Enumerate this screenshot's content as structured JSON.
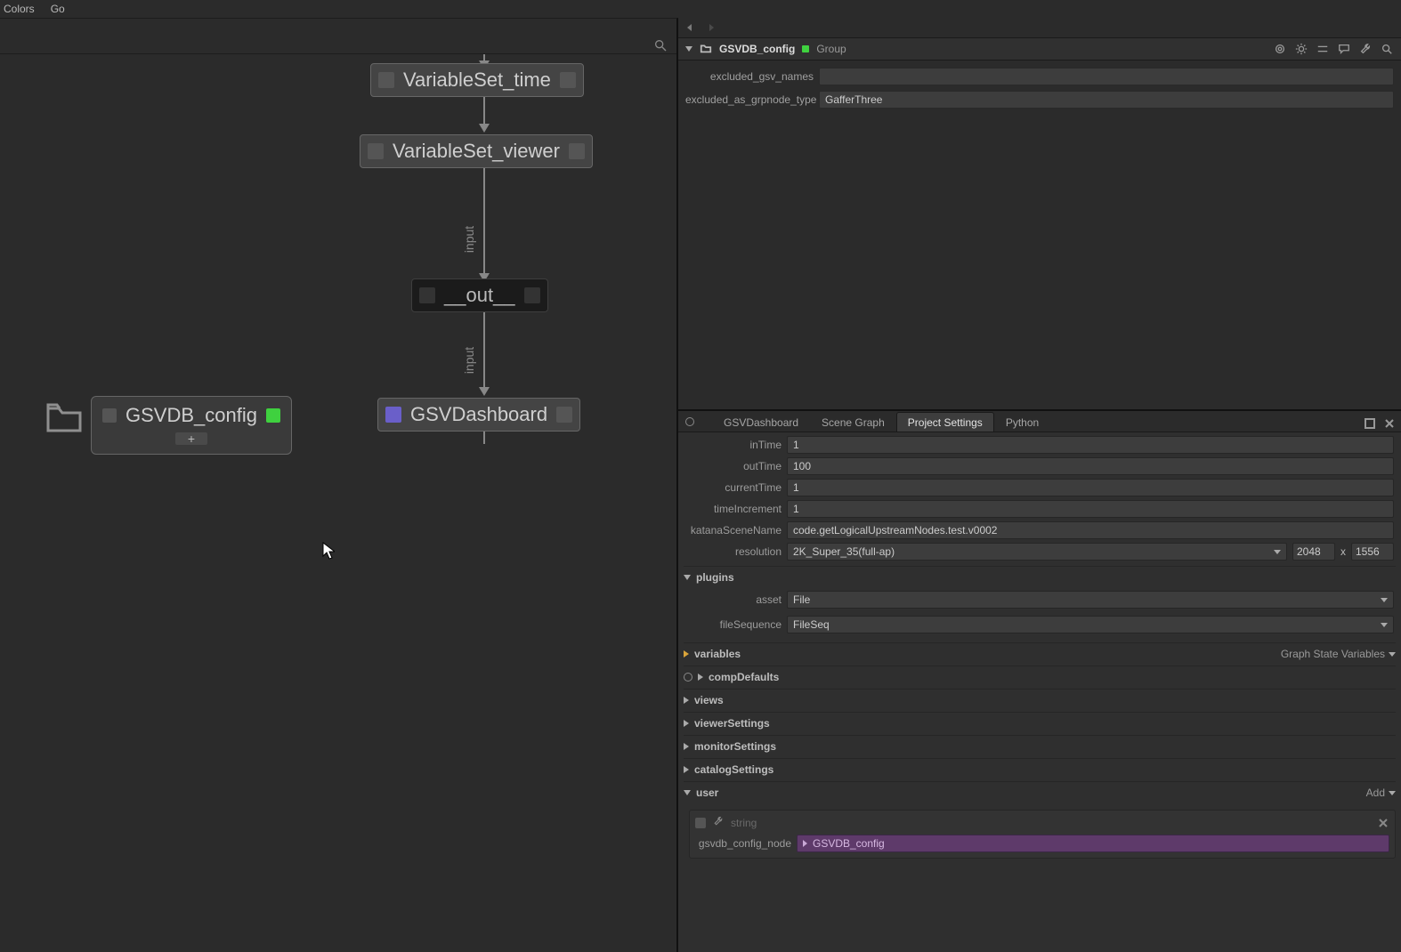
{
  "menubar": {
    "colors": "Colors",
    "go": "Go"
  },
  "nodes": {
    "vs_time": "VariableSet_time",
    "vs_viewer": "VariableSet_viewer",
    "out": "__out__",
    "dash": "GSVDashboard",
    "config": "GSVDB_config",
    "edge_label": "input"
  },
  "paramPanel": {
    "nodeName": "GSVDB_config",
    "nodeType": "Group",
    "fields": {
      "excluded_gsv_names_label": "excluded_gsv_names",
      "excluded_gsv_names_value": "",
      "excluded_as_grpnode_type_label": "excluded_as_grpnode_type",
      "excluded_as_grpnode_type_value": "GafferThree"
    }
  },
  "tabs": {
    "t0": "GSVDashboard",
    "t1": "Scene Graph",
    "t2": "Project Settings",
    "t3": "Python"
  },
  "projectSettings": {
    "inTime_label": "inTime",
    "inTime": "1",
    "outTime_label": "outTime",
    "outTime": "100",
    "currentTime_label": "currentTime",
    "currentTime": "1",
    "timeIncrement_label": "timeIncrement",
    "timeIncrement": "1",
    "katanaSceneName_label": "katanaSceneName",
    "katanaSceneName": "code.getLogicalUpstreamNodes.test.v0002",
    "resolution_label": "resolution",
    "resolution": "2K_Super_35(full-ap)",
    "res_w": "2048",
    "res_sep": "x",
    "res_h": "1556",
    "plugins_label": "plugins",
    "asset_label": "asset",
    "asset": "File",
    "fileSequence_label": "fileSequence",
    "fileSequence": "FileSeq",
    "variables_label": "variables",
    "variables_side": "Graph State Variables",
    "compDefaults_label": "compDefaults",
    "views_label": "views",
    "viewerSettings_label": "viewerSettings",
    "monitorSettings_label": "monitorSettings",
    "catalogSettings_label": "catalogSettings",
    "user_label": "user",
    "user_add": "Add",
    "user_field_type": "string",
    "gsvdb_config_node_label": "gsvdb_config_node",
    "gsvdb_config_node_value": "GSVDB_config"
  }
}
